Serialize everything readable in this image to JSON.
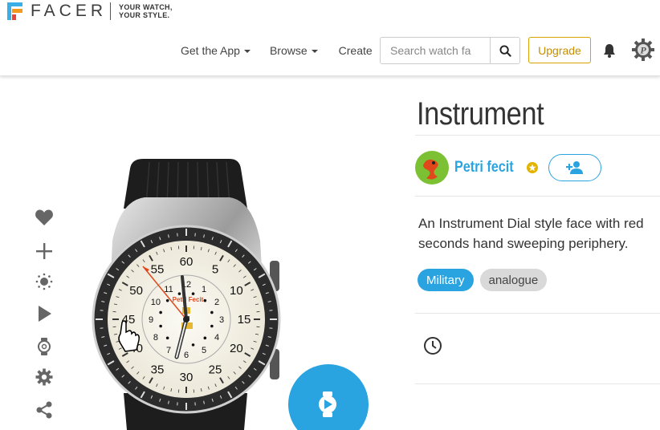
{
  "brand": {
    "name": "FACER",
    "tagline_line1": "YOUR WATCH,",
    "tagline_line2": "YOUR STYLE.",
    "colors": [
      "#3aaee6",
      "#f39a1e",
      "#e8463b"
    ]
  },
  "nav": {
    "items": [
      {
        "label": "Get the App",
        "dropdown": true
      },
      {
        "label": "Browse",
        "dropdown": true
      },
      {
        "label": "Create",
        "dropdown": false
      }
    ],
    "search_placeholder": "Search watch fa",
    "search_icon": "search-icon",
    "upgrade_label": "Upgrade",
    "notifications_icon": "bell-icon",
    "profile_icon": "gear-avatar-icon"
  },
  "actions": [
    {
      "name": "like",
      "icon": "heart-icon"
    },
    {
      "name": "add",
      "icon": "plus-icon"
    },
    {
      "name": "theme",
      "icon": "brightness-icon"
    },
    {
      "name": "play",
      "icon": "play-icon"
    },
    {
      "name": "watch-preview",
      "icon": "watch-icon"
    },
    {
      "name": "settings",
      "icon": "gear-icon"
    },
    {
      "name": "share",
      "icon": "share-icon"
    }
  ],
  "watch": {
    "brand_text": "Petri Fecit",
    "outer_numbers": [
      "60",
      "5",
      "10",
      "15",
      "20",
      "25",
      "30",
      "35",
      "40",
      "45",
      "50",
      "55"
    ],
    "inner_numbers": [
      "12",
      "1",
      "2",
      "3",
      "4",
      "5",
      "6",
      "7",
      "8",
      "9",
      "10",
      "11"
    ],
    "accent_color": "#e0471b"
  },
  "face": {
    "title": "Instrument",
    "author": "Petri fecit",
    "description": "An Instrument Dial style face with red seconds hand sweeping periphery.",
    "tags": [
      "Military",
      "analogue"
    ],
    "accent": "#2aa4e0"
  }
}
